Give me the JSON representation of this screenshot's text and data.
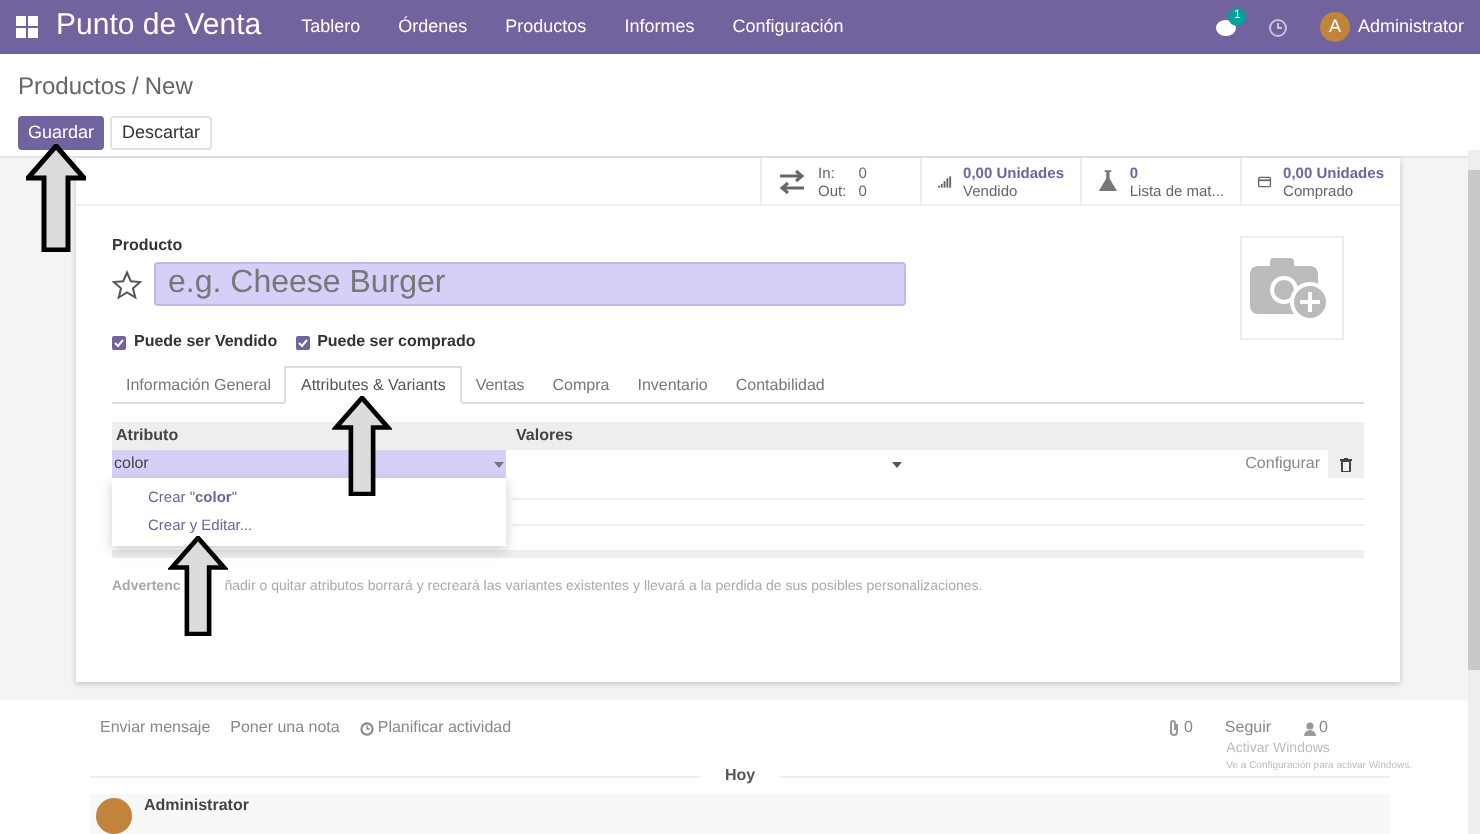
{
  "navbar": {
    "app_name": "Punto de Venta",
    "menu": [
      "Tablero",
      "Órdenes",
      "Productos",
      "Informes",
      "Configuración"
    ],
    "messages_badge": "1",
    "avatar_letter": "A",
    "user": "Administrator"
  },
  "breadcrumb": [
    "Productos",
    "/",
    "New"
  ],
  "buttons": [
    {
      "label": "Guardar",
      "kind": "primary"
    },
    {
      "label": "Descartar",
      "kind": "secondary"
    }
  ],
  "stats": [
    {
      "kind": "in_out",
      "in_label": "In:",
      "in_value": "0",
      "out_label": "Out:",
      "out_value": "0"
    },
    {
      "kind": "sold",
      "value": "0,00 Unidades",
      "label": "Vendido"
    },
    {
      "kind": "bom",
      "value": "0",
      "label": "Lista de mat..."
    },
    {
      "kind": "purchased",
      "value": "0,00 Unidades",
      "label": "Comprado"
    }
  ],
  "form": {
    "name_label": "Producto",
    "name_placeholder": "e.g. Cheese Burger",
    "starred": false,
    "checkboxes": [
      {
        "label": "Puede ser Vendido",
        "checked": true
      },
      {
        "label": "Puede ser comprado",
        "checked": true
      }
    ],
    "tabs": [
      {
        "label": "Información General",
        "selected": false
      },
      {
        "label": "Attributes & Variants",
        "selected": true
      },
      {
        "label": "Ventas",
        "selected": false
      },
      {
        "label": "Compra",
        "selected": false
      },
      {
        "label": "Inventario",
        "selected": false
      },
      {
        "label": "Contabilidad",
        "selected": false
      }
    ],
    "table": {
      "columns": [
        "Atributo",
        "Valores"
      ],
      "row": {
        "attribute": "color",
        "action": "Configurar"
      }
    },
    "dropdown": [
      "Crear \"**color**\"",
      "Crear y Editar..."
    ],
    "warning_start": "Advertenc",
    "warning_end": "ñadir o quitar atributos borrará y recreará las variantes existentes y llevará a la perdida de sus posibles personalizaciones."
  },
  "chatter": {
    "actions": [
      "Enviar mensaje",
      "Poner una nota",
      "Planificar actividad"
    ],
    "attachments": "0",
    "follow": "Seguir",
    "followers": "0",
    "day": "Hoy",
    "message_author": "Administrator"
  },
  "windows_notice": {
    "title": "Activar Windows",
    "subtitle": "Ve a Configuración para activar Windows."
  }
}
